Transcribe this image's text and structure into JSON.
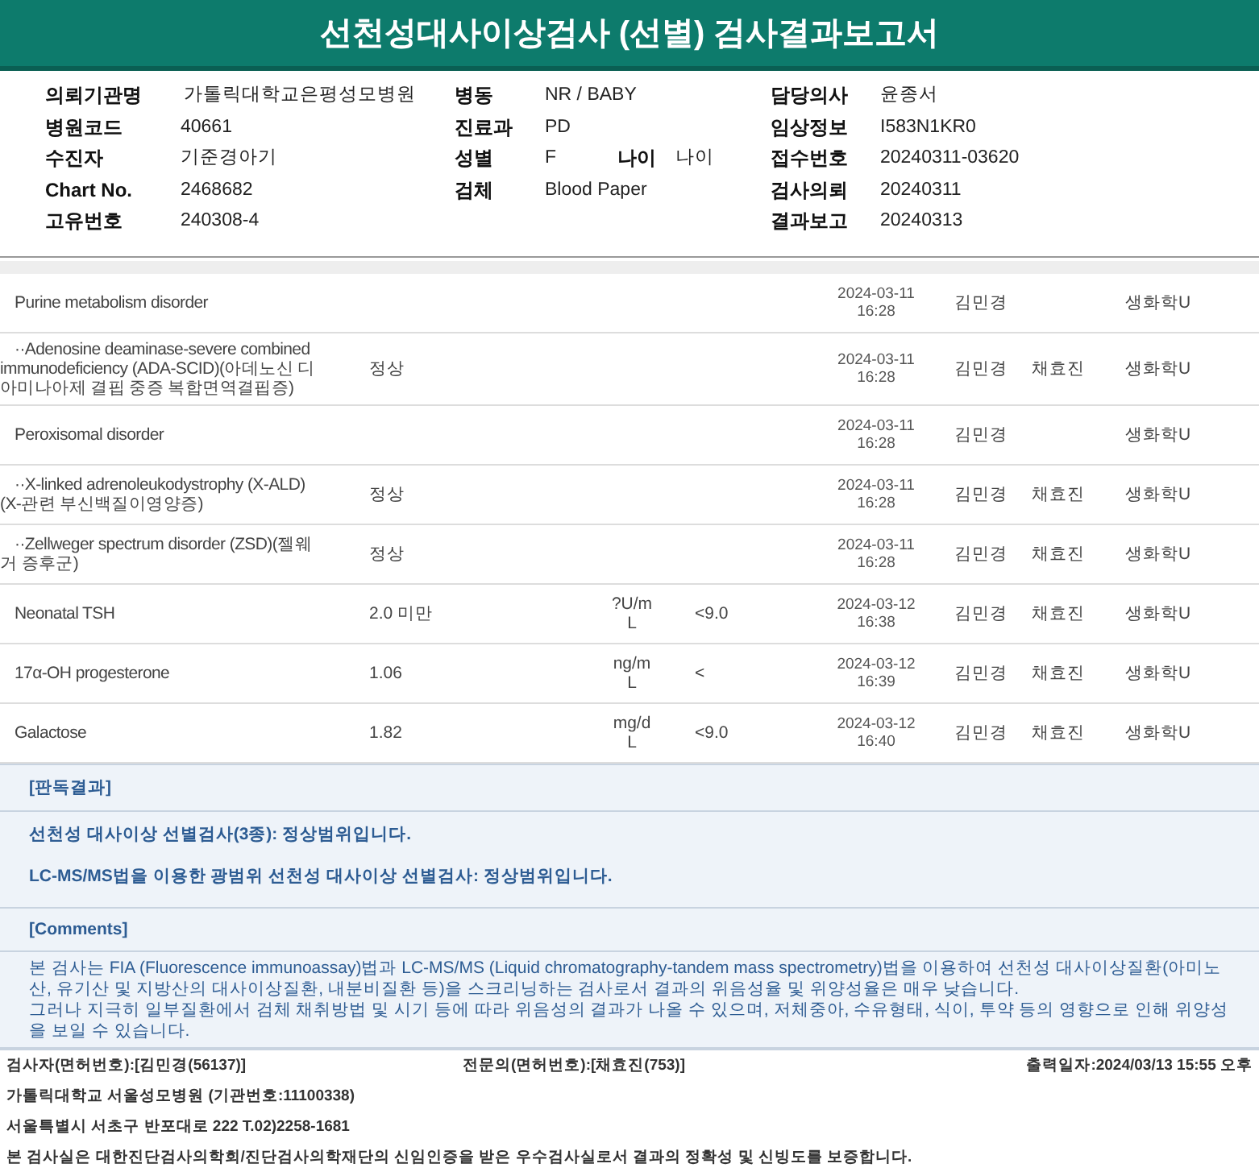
{
  "title": "선천성대사이상검사 (선별) 검사결과보고서",
  "info": [
    [
      {
        "label": "의뢰기관명",
        "value": "가톨릭대학교은평성모병원"
      },
      {
        "label": "병원코드",
        "value": "40661"
      },
      {
        "label": "수진자",
        "value": "기준경아기"
      },
      {
        "label": "Chart No.",
        "value": "2468682"
      },
      {
        "label": "고유번호",
        "value": "240308-4"
      }
    ],
    [
      {
        "label": "병동",
        "value": "NR / BABY"
      },
      {
        "label": "진료과",
        "value": "PD"
      },
      {
        "label": "성별",
        "value": "F",
        "extra_label": "나이",
        "extra_value": "나이"
      },
      {
        "label": "검체",
        "value": "Blood Paper"
      }
    ],
    [
      {
        "label": "담당의사",
        "value": "윤종서"
      },
      {
        "label": "임상정보",
        "value": "I583N1KR0"
      },
      {
        "label": "접수번호",
        "value": "20240311-03620"
      },
      {
        "label": "검사의뢰",
        "value": "20240311"
      },
      {
        "label": "결과보고",
        "value": "20240313"
      }
    ]
  ],
  "rows": [
    {
      "name": "Purine metabolism disorder",
      "date": "2024-03-11",
      "time": "16:28",
      "tester": "김민경",
      "dept": "생화학U"
    },
    {
      "name": "··Adenosine deaminase-severe combined\nimmunodeficiency (ADA-SCID)(아데노신 디\n아미나아제 결핍 중증 복합면역결핍증)",
      "result": "정상",
      "date": "2024-03-11",
      "time": "16:28",
      "tester": "김민경",
      "reviewer": "채효진",
      "dept": "생화학U"
    },
    {
      "name": "Peroxisomal disorder",
      "date": "2024-03-11",
      "time": "16:28",
      "tester": "김민경",
      "dept": "생화학U"
    },
    {
      "name": "··X-linked adrenoleukodystrophy (X-ALD)\n(X-관련 부신백질이영양증)",
      "result": "정상",
      "date": "2024-03-11",
      "time": "16:28",
      "tester": "김민경",
      "reviewer": "채효진",
      "dept": "생화학U"
    },
    {
      "name": "··Zellweger spectrum disorder (ZSD)(젤웨\n거 증후군)",
      "result": "정상",
      "date": "2024-03-11",
      "time": "16:28",
      "tester": "김민경",
      "reviewer": "채효진",
      "dept": "생화학U"
    },
    {
      "name": "Neonatal TSH",
      "result": "2.0 미만",
      "unit": "?U/mL",
      "ref": "<9.0",
      "date": "2024-03-12",
      "time": "16:38",
      "tester": "김민경",
      "reviewer": "채효진",
      "dept": "생화학U"
    },
    {
      "name": "17α-OH progesterone",
      "result": "1.06",
      "unit": "ng/mL",
      "ref": "<",
      "date": "2024-03-12",
      "time": "16:39",
      "tester": "김민경",
      "reviewer": "채효진",
      "dept": "생화학U"
    },
    {
      "name": "Galactose",
      "result": "1.82",
      "unit": "mg/dL",
      "ref": "<9.0",
      "date": "2024-03-12",
      "time": "16:40",
      "tester": "김민경",
      "reviewer": "채효진",
      "dept": "생화학U"
    }
  ],
  "interpretation": {
    "heading": "[판독결과]",
    "lines": [
      "선천성 대사이상 선별검사(3종): 정상범위입니다.",
      "LC-MS/MS법을 이용한 광범위 선천성 대사이상 선별검사: 정상범위입니다."
    ]
  },
  "comments": {
    "heading": "[Comments]",
    "lines": [
      "본 검사는 FIA (Fluorescence immunoassay)법과 LC-MS/MS (Liquid chromatography-tandem mass spectrometry)법을 이용하여 선천성 대사이상질환(아미노산, 유기산 및 지방산의 대사이상질환, 내분비질환 등)을 스크리닝하는 검사로서 결과의 위음성율 및 위양성율은 매우 낮습니다.",
      "그러나 지극히 일부질환에서 검체 채취방법 및 시기 등에 따라 위음성의 결과가 나올 수 있으며, 저체중아, 수유형태, 식이, 투약 등의 영향으로 인해 위양성을 보일 수 있습니다."
    ]
  },
  "footer": {
    "tester": "검사자(면허번호):[김민경(56137)]",
    "specialist": "전문의(면허번호):[채효진(753)]",
    "printed": "출력일자:2024/03/13 15:55 오후",
    "lines": [
      "가톨릭대학교 서울성모병원 (기관번호:11100338)",
      "서울특별시 서초구 반포대로 222 T.02)2258-1681",
      "본 검사실은 대한진단검사의학회/진단검사의학재단의 신임인증을 받은 우수검사실로서 결과의 정확성 및 신빙도를 보증합니다."
    ]
  }
}
